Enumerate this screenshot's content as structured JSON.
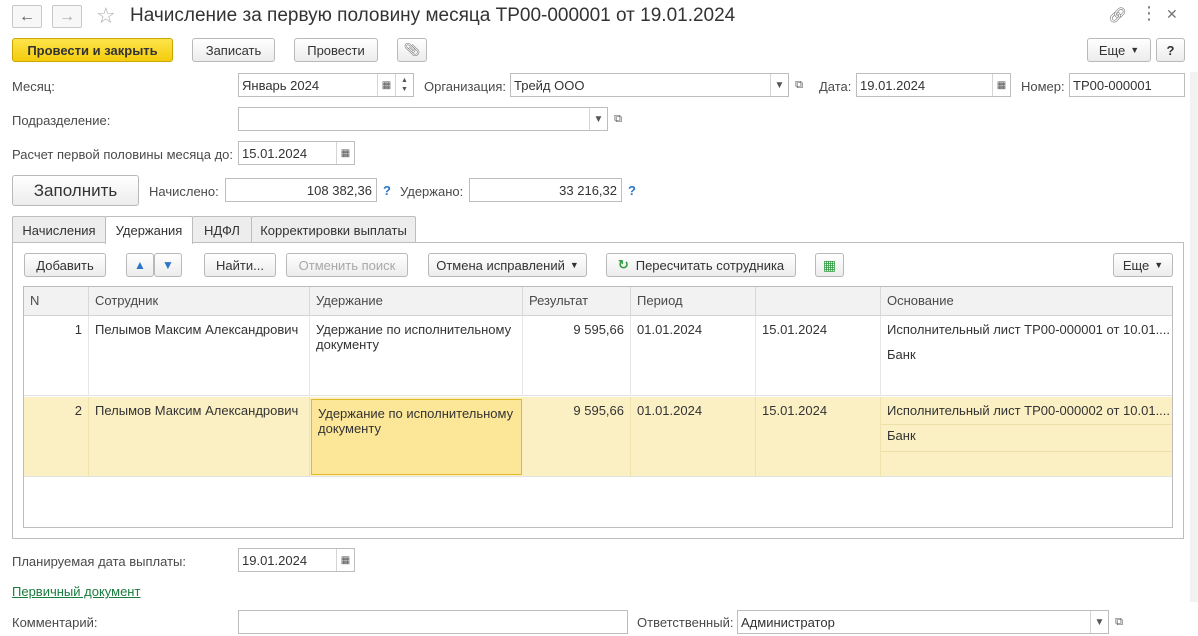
{
  "window": {
    "title": "Начисление за первую половину месяца ТР00-000001 от 19.01.2024"
  },
  "toolbar": {
    "post_close_label": "Провести и закрыть",
    "save_label": "Записать",
    "post_label": "Провести",
    "more_label": "Еще",
    "help_label": "?"
  },
  "form": {
    "month": {
      "label": "Месяц:",
      "value": "Январь 2024"
    },
    "organization": {
      "label": "Организация:",
      "value": "Трейд ООО"
    },
    "date": {
      "label": "Дата:",
      "value": "19.01.2024"
    },
    "number": {
      "label": "Номер:",
      "value": "ТР00-000001"
    },
    "department": {
      "label": "Подразделение:",
      "value": ""
    },
    "calc_until": {
      "label": "Расчет первой половины месяца до:",
      "value": "15.01.2024"
    },
    "fill_label": "Заполнить",
    "accrued": {
      "label": "Начислено:",
      "value": "108 382,36"
    },
    "withheld": {
      "label": "Удержано:",
      "value": "33 216,32"
    },
    "help": "?"
  },
  "tabs": [
    {
      "label": "Начисления",
      "active": false
    },
    {
      "label": "Удержания",
      "active": true
    },
    {
      "label": "НДФЛ",
      "active": false
    },
    {
      "label": "Корректировки выплаты",
      "active": false
    }
  ],
  "table_toolbar": {
    "add_label": "Добавить",
    "find_label": "Найти...",
    "cancel_search_label": "Отменить поиск",
    "cancel_corrections_label": "Отмена исправлений",
    "recalc_label": "Пересчитать сотрудника",
    "more_label": "Еще"
  },
  "table": {
    "columns": [
      "N",
      "Сотрудник",
      "Удержание",
      "Результат",
      "Период",
      "",
      "Основание"
    ],
    "rows": [
      {
        "n": "1",
        "employee": "Пелымов Максим Александрович",
        "deduction": "Удержание по исполнительному документу",
        "result": "9 595,66",
        "period_from": "01.01.2024",
        "period_to": "15.01.2024",
        "basis": "Исполнительный лист ТР00-000001 от 10.01....",
        "basis2": "Банк"
      },
      {
        "n": "2",
        "employee": "Пелымов Максим Александрович",
        "deduction": "Удержание по исполнительному документу",
        "result": "9 595,66",
        "period_from": "01.01.2024",
        "period_to": "15.01.2024",
        "basis": "Исполнительный лист ТР00-000002 от 10.01....",
        "basis2": "Банк"
      }
    ]
  },
  "footer": {
    "pay_date": {
      "label": "Планируемая дата выплаты:",
      "value": "19.01.2024"
    },
    "primary_doc_link": "Первичный документ",
    "comment_label": "Комментарий:",
    "comment_value": "",
    "responsible_label": "Ответственный:",
    "responsible_value": "Администратор"
  },
  "colors": {
    "primary_button": "#f4cc0c",
    "selected_row": "#fbf0c4",
    "focus_cell": "#fce698",
    "link": "#1a7c3e",
    "help": "#2d76c7"
  }
}
